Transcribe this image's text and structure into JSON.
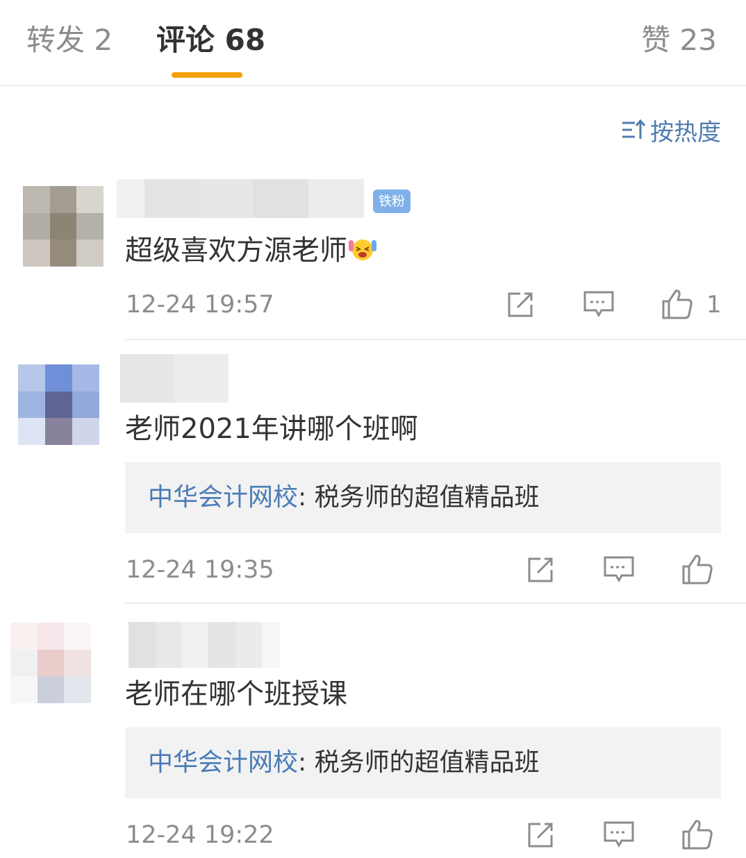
{
  "tabs": {
    "repost": "转发 2",
    "comments": "评论 68",
    "likes": "赞 23"
  },
  "sort": {
    "label": "按热度",
    "icon": "sort-icon"
  },
  "accent": {
    "tab_underline": "#f5a000",
    "link": "#4a7bb7",
    "badge": "#7fb0ea"
  },
  "comments": [
    {
      "badge": "铁粉",
      "text": "超级喜欢方源老师",
      "emoji": "laugh-cry-emoji",
      "time": "12-24 19:57",
      "likes": "1"
    },
    {
      "text": "老师2021年讲哪个班啊",
      "reply": {
        "author": "中华会计网校",
        "separator": ":",
        "text": " 税务师的超值精品班"
      },
      "time": "12-24 19:35"
    },
    {
      "text": "老师在哪个班授课",
      "reply": {
        "author": "中华会计网校",
        "separator": ":",
        "text": " 税务师的超值精品班"
      },
      "time": "12-24 19:22"
    }
  ]
}
